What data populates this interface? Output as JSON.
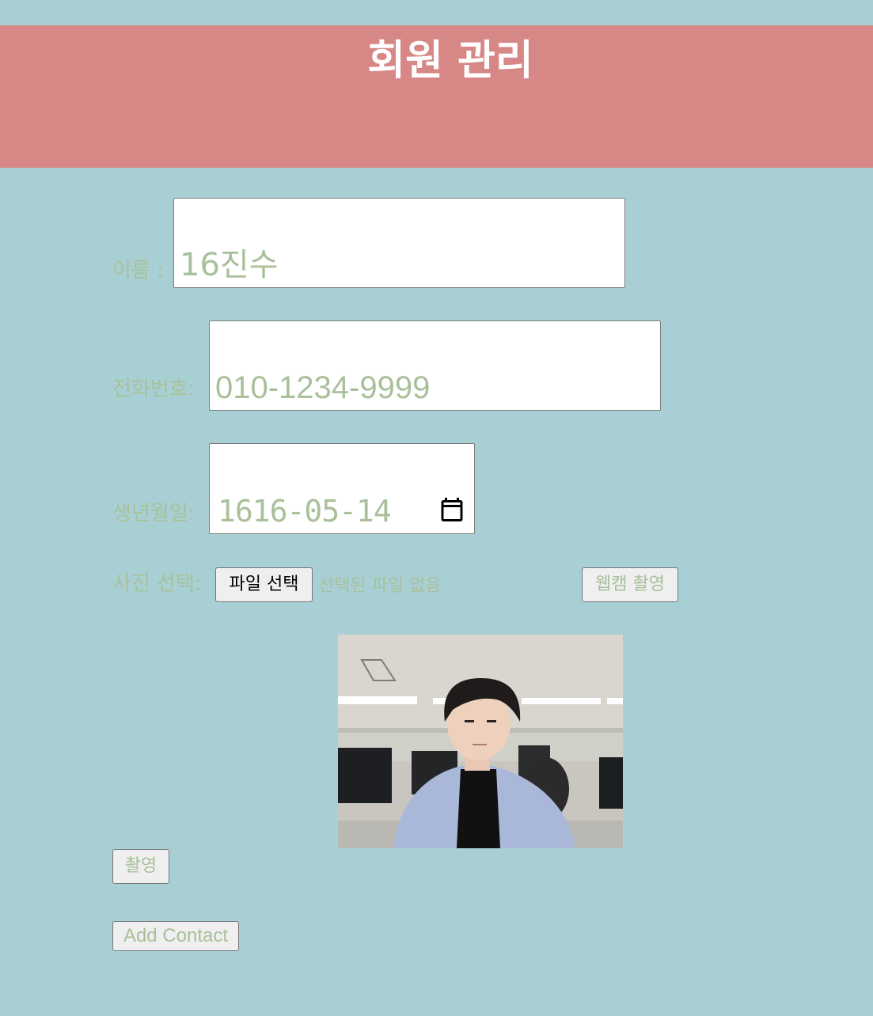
{
  "header": {
    "title": "회원 관리"
  },
  "form": {
    "name": {
      "label": "이름 :",
      "value": "16진수"
    },
    "phone": {
      "label": "전화번호:",
      "value": "010-1234-9999"
    },
    "birth": {
      "label": "생년월일:",
      "value": "1616-05-14",
      "icon": "calendar-icon"
    },
    "photo": {
      "label": "사진 선택:",
      "file_button": "파일 선택",
      "file_status": "선택된 파일 없음",
      "webcam_button": "웹캠 촬영",
      "preview_alt": "webcam-photo-preview"
    },
    "capture_button": "촬영",
    "add_button": "Add Contact"
  },
  "colors": {
    "background": "#a8d0d4",
    "header": "#d78886",
    "text_accent": "#a9c09b"
  }
}
